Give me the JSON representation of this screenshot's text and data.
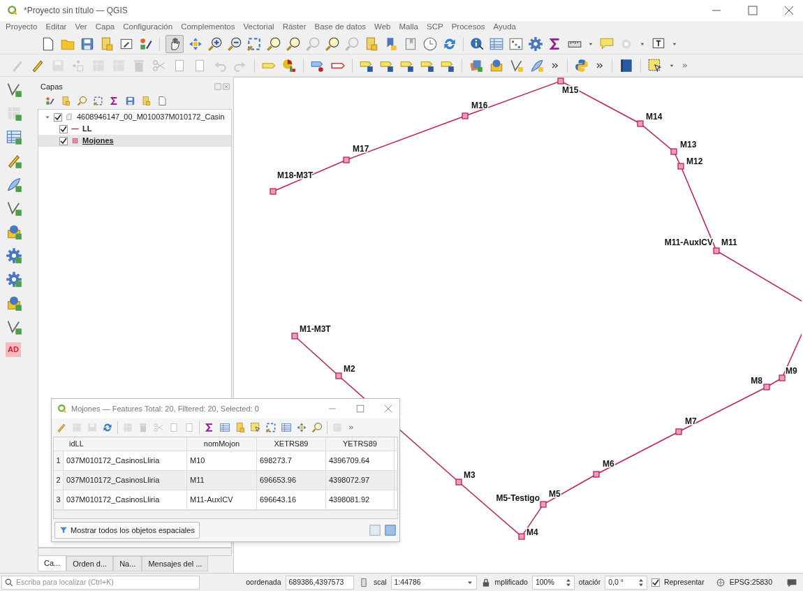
{
  "window": {
    "title": "*Proyecto sin título — QGIS"
  },
  "menu": [
    "Proyecto",
    "Editar",
    "Ver",
    "Capa",
    "Configuración",
    "Complementos",
    "Vectorial",
    "Ráster",
    "Base de datos",
    "Web",
    "Malla",
    "SCP",
    "Procesos",
    "Ayuda"
  ],
  "map_navigation": {
    "pan_tool_selected": true
  },
  "left_toolbar": {
    "badge": "AD"
  },
  "layers_panel": {
    "title": "Capas",
    "tree": [
      {
        "label": "4608946147_00_M010037M010172_Casin",
        "checked": true,
        "expanded": true,
        "selected": false,
        "children": [
          {
            "label": "LL",
            "checked": true,
            "selected": false,
            "kind": "line"
          },
          {
            "label": "Mojones",
            "checked": true,
            "selected": true,
            "kind": "point"
          }
        ]
      }
    ]
  },
  "panel_tabs": [
    {
      "label": "Ca...",
      "selected": true
    },
    {
      "label": "Orden d...",
      "selected": false
    },
    {
      "label": "Na...",
      "selected": false
    },
    {
      "label": "Mensajes del ...",
      "selected": false
    }
  ],
  "map": {
    "labels": [
      "M15",
      "M16",
      "M14",
      "M13",
      "M12",
      "M17",
      "M18-M3T",
      "M11-AuxICV",
      "M11",
      "M1-M3T",
      "M2",
      "M9",
      "M8",
      "M7",
      "M3",
      "M6",
      "M5-Testigo",
      "M5",
      "M4"
    ]
  },
  "attribute_table": {
    "title": "Mojones — Features Total: 20, Filtered: 20, Selected: 0",
    "columns": [
      "idLL",
      "nomMojon",
      "XETRS89",
      "YETRS89"
    ],
    "rows": [
      {
        "number": "1",
        "cells": [
          "037M010172_CasinosLliria",
          "M10",
          "698273.7",
          "4396709.64"
        ]
      },
      {
        "number": "2",
        "cells": [
          "037M010172_CasinosLliria",
          "M11",
          "696653.96",
          "4398072.97"
        ]
      },
      {
        "number": "3",
        "cells": [
          "037M010172_CasinosLliria",
          "M11-AuxICV",
          "696643.16",
          "4398081.92"
        ]
      }
    ],
    "filter_button": "Mostrar todos los objetos espaciales"
  },
  "status_bar": {
    "search_placeholder": "Escriba para localizar (Ctrl+K)",
    "coordinate_label": "oordenada",
    "coordinate": "689386,4397573",
    "scale_label": "scal",
    "scale": "1:44786",
    "magnifier_label": "mplificado",
    "magnifier": "100%",
    "rotation_label": "otaciór",
    "rotation": "0,0 °",
    "render": {
      "label": "Representar",
      "checked": true
    },
    "crs": "EPSG:25830"
  }
}
